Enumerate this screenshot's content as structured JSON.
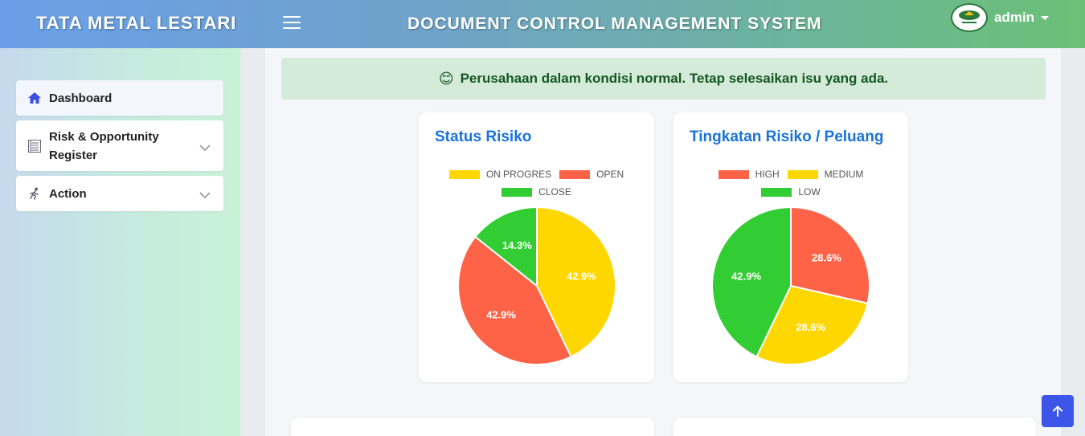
{
  "header": {
    "brand": "TATA METAL LESTARI",
    "title": "DOCUMENT CONTROL MANAGEMENT SYSTEM",
    "user": "admin"
  },
  "sidebar": {
    "items": [
      {
        "label": "Dashboard",
        "icon": "home-icon",
        "active": true
      },
      {
        "label": "Risk & Opportunity Register",
        "icon": "register-icon",
        "expandable": true
      },
      {
        "label": "Action",
        "icon": "running-person-icon",
        "expandable": true
      }
    ]
  },
  "alert": {
    "emoji": "😊",
    "text": "Perusahaan dalam kondisi normal. Tetap selesaikan isu yang ada."
  },
  "colors": {
    "yellow": "#FFD700",
    "red": "#FF6347",
    "green": "#32CD32",
    "title_blue": "#1a73d9"
  },
  "chart_data": [
    {
      "type": "pie",
      "title": "Status Risiko",
      "legend": [
        "ON PROGRES",
        "OPEN",
        "CLOSE"
      ],
      "values": [
        42.9,
        42.9,
        14.3
      ],
      "labels": [
        "42.9%",
        "42.9%",
        "14.3%"
      ],
      "colors": [
        "#FFD700",
        "#FF6347",
        "#32CD32"
      ]
    },
    {
      "type": "pie",
      "title": "Tingkatan Risiko / Peluang",
      "legend": [
        "HIGH",
        "MEDIUM",
        "LOW"
      ],
      "values": [
        28.6,
        28.6,
        42.9
      ],
      "labels": [
        "28.6%",
        "28.6%",
        "42.9%"
      ],
      "colors": [
        "#FF6347",
        "#FFD700",
        "#32CD32"
      ]
    }
  ]
}
